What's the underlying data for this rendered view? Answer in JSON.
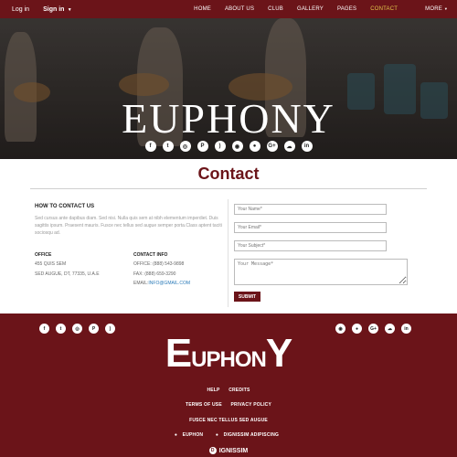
{
  "topbar": {
    "login": "Log in",
    "signin": "Sign in",
    "nav": [
      {
        "label": "HOME",
        "active": false
      },
      {
        "label": "ABOUT US",
        "active": false
      },
      {
        "label": "CLUB",
        "active": false
      },
      {
        "label": "GALLERY",
        "active": false
      },
      {
        "label": "PAGES",
        "active": false
      },
      {
        "label": "CONTACT",
        "active": true
      },
      {
        "label": "MORE",
        "active": false
      }
    ]
  },
  "hero": {
    "title": "EUPHONY",
    "social": [
      "f",
      "t",
      "ig",
      "p",
      "rss",
      "dr",
      "ap",
      "g+",
      "cl",
      "in"
    ]
  },
  "main": {
    "title": "Contact",
    "how_heading": "HOW TO CONTACT US",
    "how_text": "Sed cursus ante dapibus diam. Sed nisi. Nulla quis sem at nibh elementum imperdiet. Duis sagittis ipsum. Praesent mauris. Fusce nec tellus sed augue semper porta.Class aptent taciti sociosqu ad.",
    "office_heading": "OFFICE",
    "office_line1": "455 QUIS SEM",
    "office_line2": "SED AUGUE, DT, 77335, U.A.E",
    "contact_heading": "CONTACT INFO",
    "office_phone": "OFFICE: (888) 543-9898",
    "fax": "FAX: (888) 659-3290",
    "email_label": "EMAIL:",
    "email": "INFO@GMAIL.COM",
    "form": {
      "name_placeholder": "Your Name*",
      "email_placeholder": "Your Email*",
      "subject_placeholder": "Your Subject*",
      "message_placeholder": "Your Message*",
      "submit": "SUBMIT"
    }
  },
  "footer": {
    "social_left": [
      "f",
      "t",
      "ig",
      "p",
      "rss"
    ],
    "social_right": [
      "dr",
      "ap",
      "g+",
      "cl",
      "in"
    ],
    "logo_e": "E",
    "logo_mid": "UPHON",
    "logo_y": "Y",
    "links_row1": [
      "HELP",
      "CREDITS"
    ],
    "links_row2": [
      "TERMS OF USE",
      "PRIVACY POLICY"
    ],
    "links_row3": "FUSCE NEC TELLUS SED AUGUE",
    "links_row4": [
      "EUPHON",
      "DIGNISSIM ADIPISCING"
    ],
    "brand_icon": "D",
    "brand": "IGNISSIM"
  },
  "colors": {
    "brand": "#6b1419",
    "accent": "#e2c84a"
  }
}
